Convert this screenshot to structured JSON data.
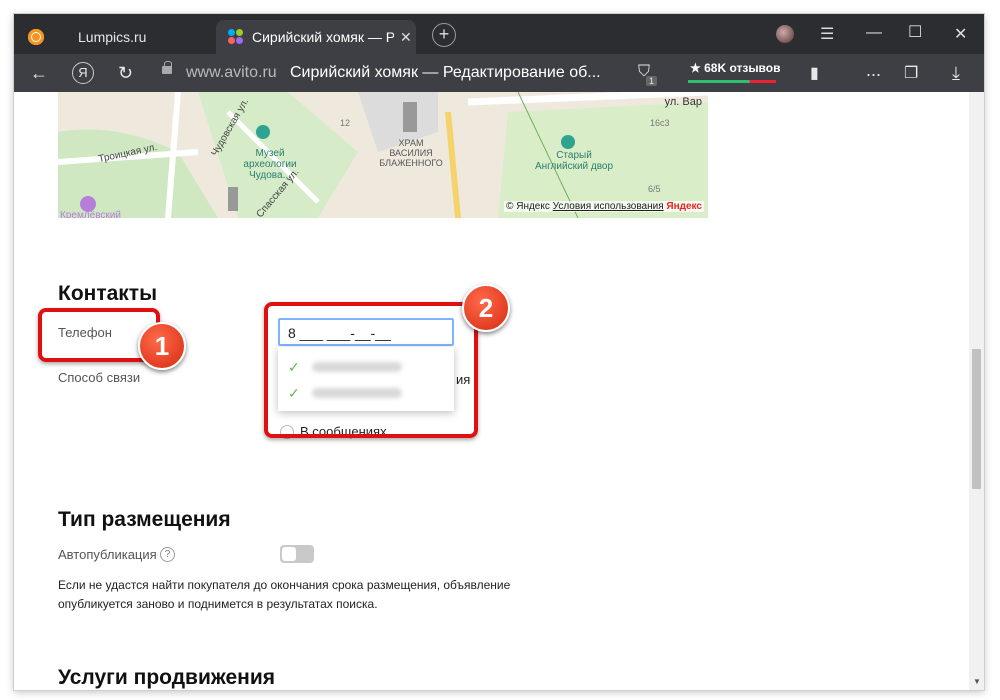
{
  "tabs": [
    {
      "title": "Lumpics.ru"
    },
    {
      "title": "Сирийский хомяк — Редактирование объявления"
    }
  ],
  "toolbar": {
    "domain": "www.avito.ru",
    "page_title": "Сирийский хомяк — Редактирование об...",
    "reviews": "★ 68K отзывов",
    "shield_count": "1",
    "menu_more": "..."
  },
  "map": {
    "labels": [
      "ул. Вар",
      "Музей археологии Чудова...",
      "ХРАМ ВАСИЛИЯ БЛАЖЕННОГО",
      "Старый Английский двор",
      "Троицкая ул.",
      "Чудовская ул.",
      "Спасская ул.",
      "Кремлёвский",
      "12",
      "16с3",
      "6/5"
    ],
    "copyright": "© Яндекс",
    "terms": "Условия использования",
    "brand": "Яндекс"
  },
  "contacts": {
    "title": "Контакты",
    "phone_label": "Телефон",
    "phone_value": "8 ___ ___-__-__",
    "method_label": "Способ связи",
    "option_partial": "ия",
    "option_messages": "В сообщениях"
  },
  "placement": {
    "title": "Тип размещения",
    "autopub_label": "Автопубликация",
    "help": "?",
    "autopub_on": false,
    "desc": "Если не удастся найти покупателя до окончания срока размещения, объявление опубликуется заново и поднимется в результатах поиска."
  },
  "promo": {
    "title": "Услуги продвижения"
  },
  "annotations": [
    {
      "number": "1"
    },
    {
      "number": "2"
    }
  ],
  "colors": {
    "accent": "#e01010",
    "focus": "#7fb4ff",
    "check": "#6bb35a"
  }
}
